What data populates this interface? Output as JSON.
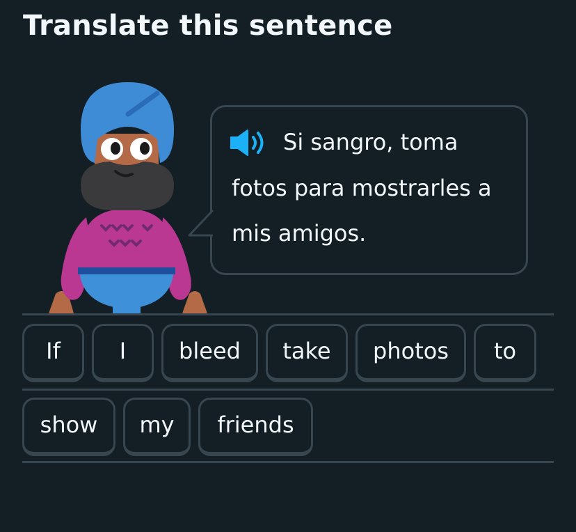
{
  "header": {
    "title": "Translate this sentence"
  },
  "prompt": {
    "speaker_icon": "speaker-icon",
    "sentence": "Si sangro, toma fotos para mostrarles a mis amigos."
  },
  "word_bank": {
    "row1": [
      "If",
      "I",
      "bleed",
      "take",
      "photos",
      "to"
    ],
    "row2": [
      "show",
      "my",
      "friends"
    ]
  },
  "colors": {
    "background": "#131f24",
    "border": "#37464f",
    "text": "#f1f7fb",
    "speaker": "#1cb0f6"
  }
}
